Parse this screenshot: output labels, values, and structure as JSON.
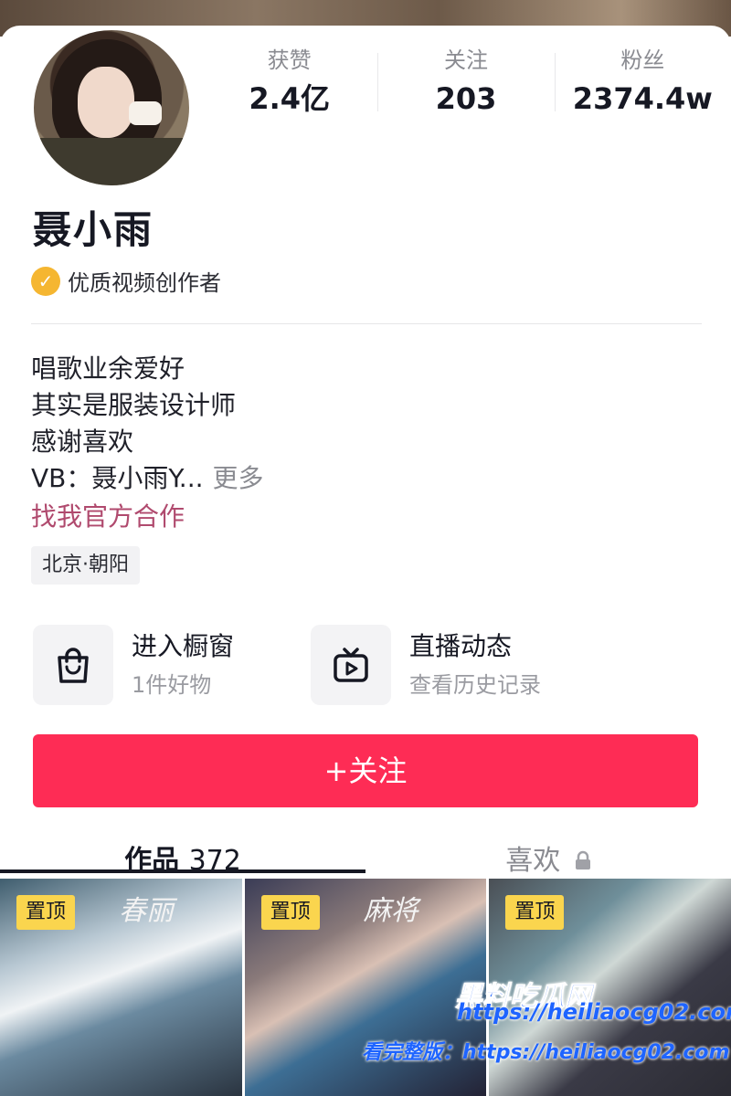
{
  "profile": {
    "name": "聂小雨",
    "badge": "优质视频创作者",
    "stats": [
      {
        "label": "获赞",
        "value": "2.4亿"
      },
      {
        "label": "关注",
        "value": "203"
      },
      {
        "label": "粉丝",
        "value": "2374.4w"
      }
    ],
    "bio": [
      "唱歌业余爱好",
      "其实是服装设计师",
      "感谢喜欢"
    ],
    "bio_vb": "VB：聂小雨Y...",
    "bio_more": "更多",
    "collab": "找我官方合作",
    "location": "北京·朝阳"
  },
  "entries": [
    {
      "title": "进入橱窗",
      "sub": "1件好物",
      "icon": "shopping-bag-icon"
    },
    {
      "title": "直播动态",
      "sub": "查看历史记录",
      "icon": "tv-play-icon"
    }
  ],
  "follow_button": "+关注",
  "tabs": {
    "works_label": "作品",
    "works_count": "372",
    "likes_label": "喜欢"
  },
  "videos": [
    {
      "pin": "置顶",
      "title": "春丽"
    },
    {
      "pin": "置顶",
      "title": "麻将"
    },
    {
      "pin": "置顶",
      "title": ""
    }
  ],
  "watermark": {
    "brand": "黑料吃瓜网",
    "url": "https://heiliaocg02.com",
    "line": "看完整版：https://heiliaocg02.com"
  },
  "colors": {
    "accent": "#fe2c55",
    "pin": "#fad54e",
    "badge": "#f5b631",
    "collab": "#b04a6e"
  }
}
